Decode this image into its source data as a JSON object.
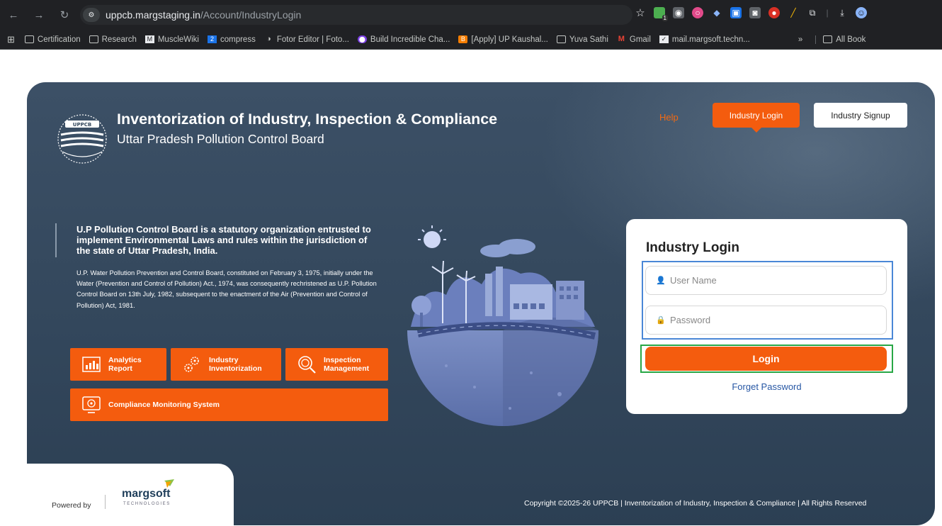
{
  "browser": {
    "url_host": "uppcb.margstaging.in",
    "url_path": "/Account/IndustryLogin",
    "bookmarks": [
      {
        "label": "Certification",
        "icon": "folder-icon"
      },
      {
        "label": "Research",
        "icon": "folder-icon"
      },
      {
        "label": "MuscleWiki",
        "icon": "musclewiki-icon"
      },
      {
        "label": "compress",
        "icon": "compress-icon"
      },
      {
        "label": "Fotor Editor | Foto...",
        "icon": "fotor-icon"
      },
      {
        "label": "Build Incredible Cha...",
        "icon": "build-icon"
      },
      {
        "label": "[Apply] UP Kaushal...",
        "icon": "blogger-icon"
      },
      {
        "label": "Yuva Sathi",
        "icon": "folder-icon"
      },
      {
        "label": "Gmail",
        "icon": "gmail-icon"
      },
      {
        "label": "mail.margsoft.techn...",
        "icon": "mail-icon"
      }
    ],
    "overflow_label": "»",
    "all_bookmarks_label": "All Book",
    "extension_badge": "1"
  },
  "header": {
    "title": "Inventorization of Industry, Inspection & Compliance",
    "subtitle": "Uttar Pradesh Pollution Control Board",
    "logo_text": "UPPCB",
    "nav": {
      "help": "Help",
      "login": "Industry Login",
      "signup": "Industry Signup"
    }
  },
  "about": {
    "heading": "U.P Pollution Control Board is a statutory organization entrusted to implement Environmental Laws and rules within the jurisdiction of the state of Uttar Pradesh, India.",
    "body": "U.P. Water Pollution Prevention and Control Board, constituted on February 3, 1975, initially under the Water (Prevention and Control of Pollution) Act., 1974, was consequently rechristened as U.P. Pollution Control Board on 13th July, 1982, subsequent to the enactment of the Air (Prevention and Control of Pollution) Act, 1981."
  },
  "features": [
    {
      "line1": "Analytics",
      "line2": "Report"
    },
    {
      "line1": "Industry",
      "line2": "Inventorization"
    },
    {
      "line1": "Inspection",
      "line2": "Management"
    },
    {
      "line1": "Compliance Monitoring System",
      "line2": ""
    }
  ],
  "login": {
    "title": "Industry Login",
    "username_placeholder": "User Name",
    "password_placeholder": "Password",
    "button": "Login",
    "forget": "Forget Password"
  },
  "footer": {
    "powered_by": "Powered by",
    "brand": "margsoft",
    "brand_sub": "TECHNOLOGIES",
    "copyright": "Copyright ©2025-26 UPPCB | Inventorization of Industry, Inspection & Compliance | All Rights Reserved"
  },
  "colors": {
    "accent": "#f45c0e",
    "hero_bg": "#33475c",
    "link": "#2757a4",
    "highlight_blue": "#4a87d6",
    "highlight_green": "#28a745"
  }
}
